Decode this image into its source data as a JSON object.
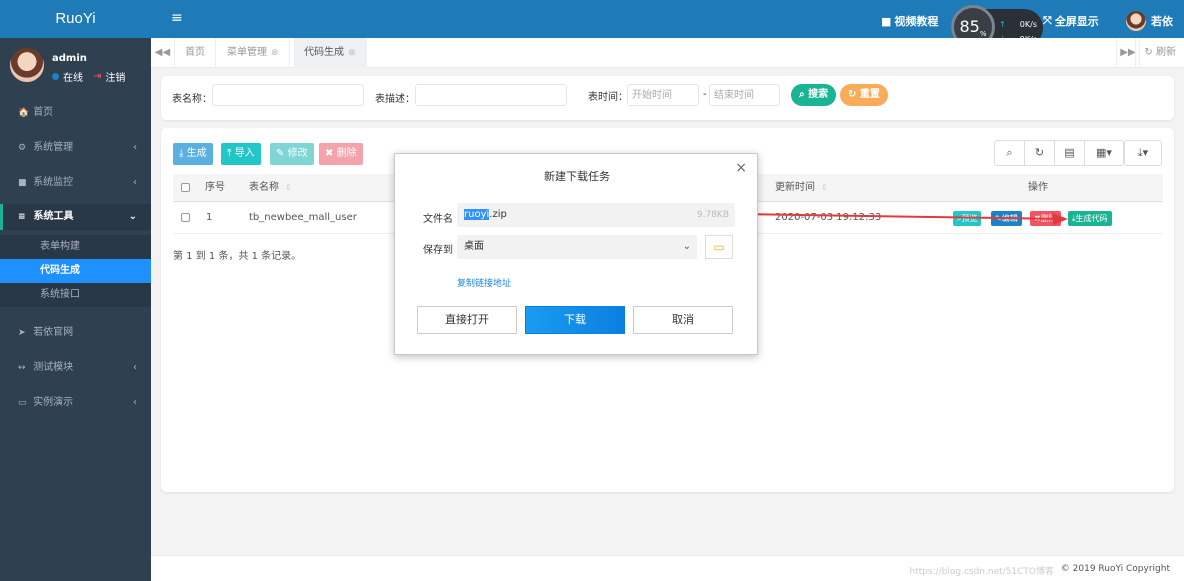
{
  "brand": "RuoYi",
  "user": {
    "name": "admin",
    "status": "在线",
    "logout": "注销"
  },
  "sidebar": {
    "items": [
      {
        "icon": "🏠",
        "label": "首页"
      },
      {
        "icon": "⚙",
        "label": "系统管理"
      },
      {
        "icon": "■",
        "label": "系统监控"
      },
      {
        "icon": "≡",
        "label": "系统工具"
      },
      {
        "icon": "➤",
        "label": "若依官网"
      },
      {
        "icon": "↔",
        "label": "测试模块"
      },
      {
        "icon": "▭",
        "label": "实例演示"
      }
    ],
    "sub_items": [
      "表单构建",
      "代码生成",
      "系统接口"
    ]
  },
  "topbar": {
    "video": "视频教程",
    "fullscreen": "全屏显示",
    "username": "若依",
    "speed": {
      "percent": "85",
      "unit": "%",
      "up": "0",
      "down": "9",
      "rate_unit": "K/s"
    }
  },
  "tabs": [
    "首页",
    "菜单管理",
    "代码生成"
  ],
  "refresh": "刷新",
  "search": {
    "table_name_label": "表名称：",
    "table_desc_label": "表描述：",
    "time_label": "表时间：",
    "start_placeholder": "开始时间",
    "end_placeholder": "结束时间",
    "dash": "-",
    "search_btn": "搜索",
    "reset_btn": "重置"
  },
  "toolbar": {
    "generate": "生成",
    "import": "导入",
    "edit": "修改",
    "delete": "删除"
  },
  "table": {
    "headers": {
      "no": "序号",
      "name": "表名称",
      "update_time": "更新时间",
      "ops": "操作"
    },
    "row": {
      "no": "1",
      "name": "tb_newbee_mall_user",
      "update_time": "2020-07-03 19:12:33"
    },
    "ops": [
      "预览",
      "编辑",
      "删除",
      "生成代码"
    ]
  },
  "pagination": "第 1 到 1 条，共 1 条记录。",
  "modal": {
    "title": "新建下载任务",
    "filename_label": "文件名",
    "filename_selected": "ruoyi",
    "filename_ext": ".zip",
    "filesize": "9.78KB",
    "saveto_label": "保存到",
    "saveto_value": "桌面",
    "copy_link": "复制链接地址",
    "open_btn": "直接打开",
    "download_btn": "下载",
    "cancel_btn": "取消"
  },
  "footer": {
    "copyright": "© 2019 RuoYi Copyright",
    "watermark": "https://blog.csdn.net/51CTO博客"
  },
  "colors": {
    "topbar": "#1e7bb7",
    "sidebar": "#2f4050",
    "primary": "#1ab394",
    "danger": "#ed5565",
    "info": "#23c6c8",
    "arrow": "#e03a3a"
  }
}
